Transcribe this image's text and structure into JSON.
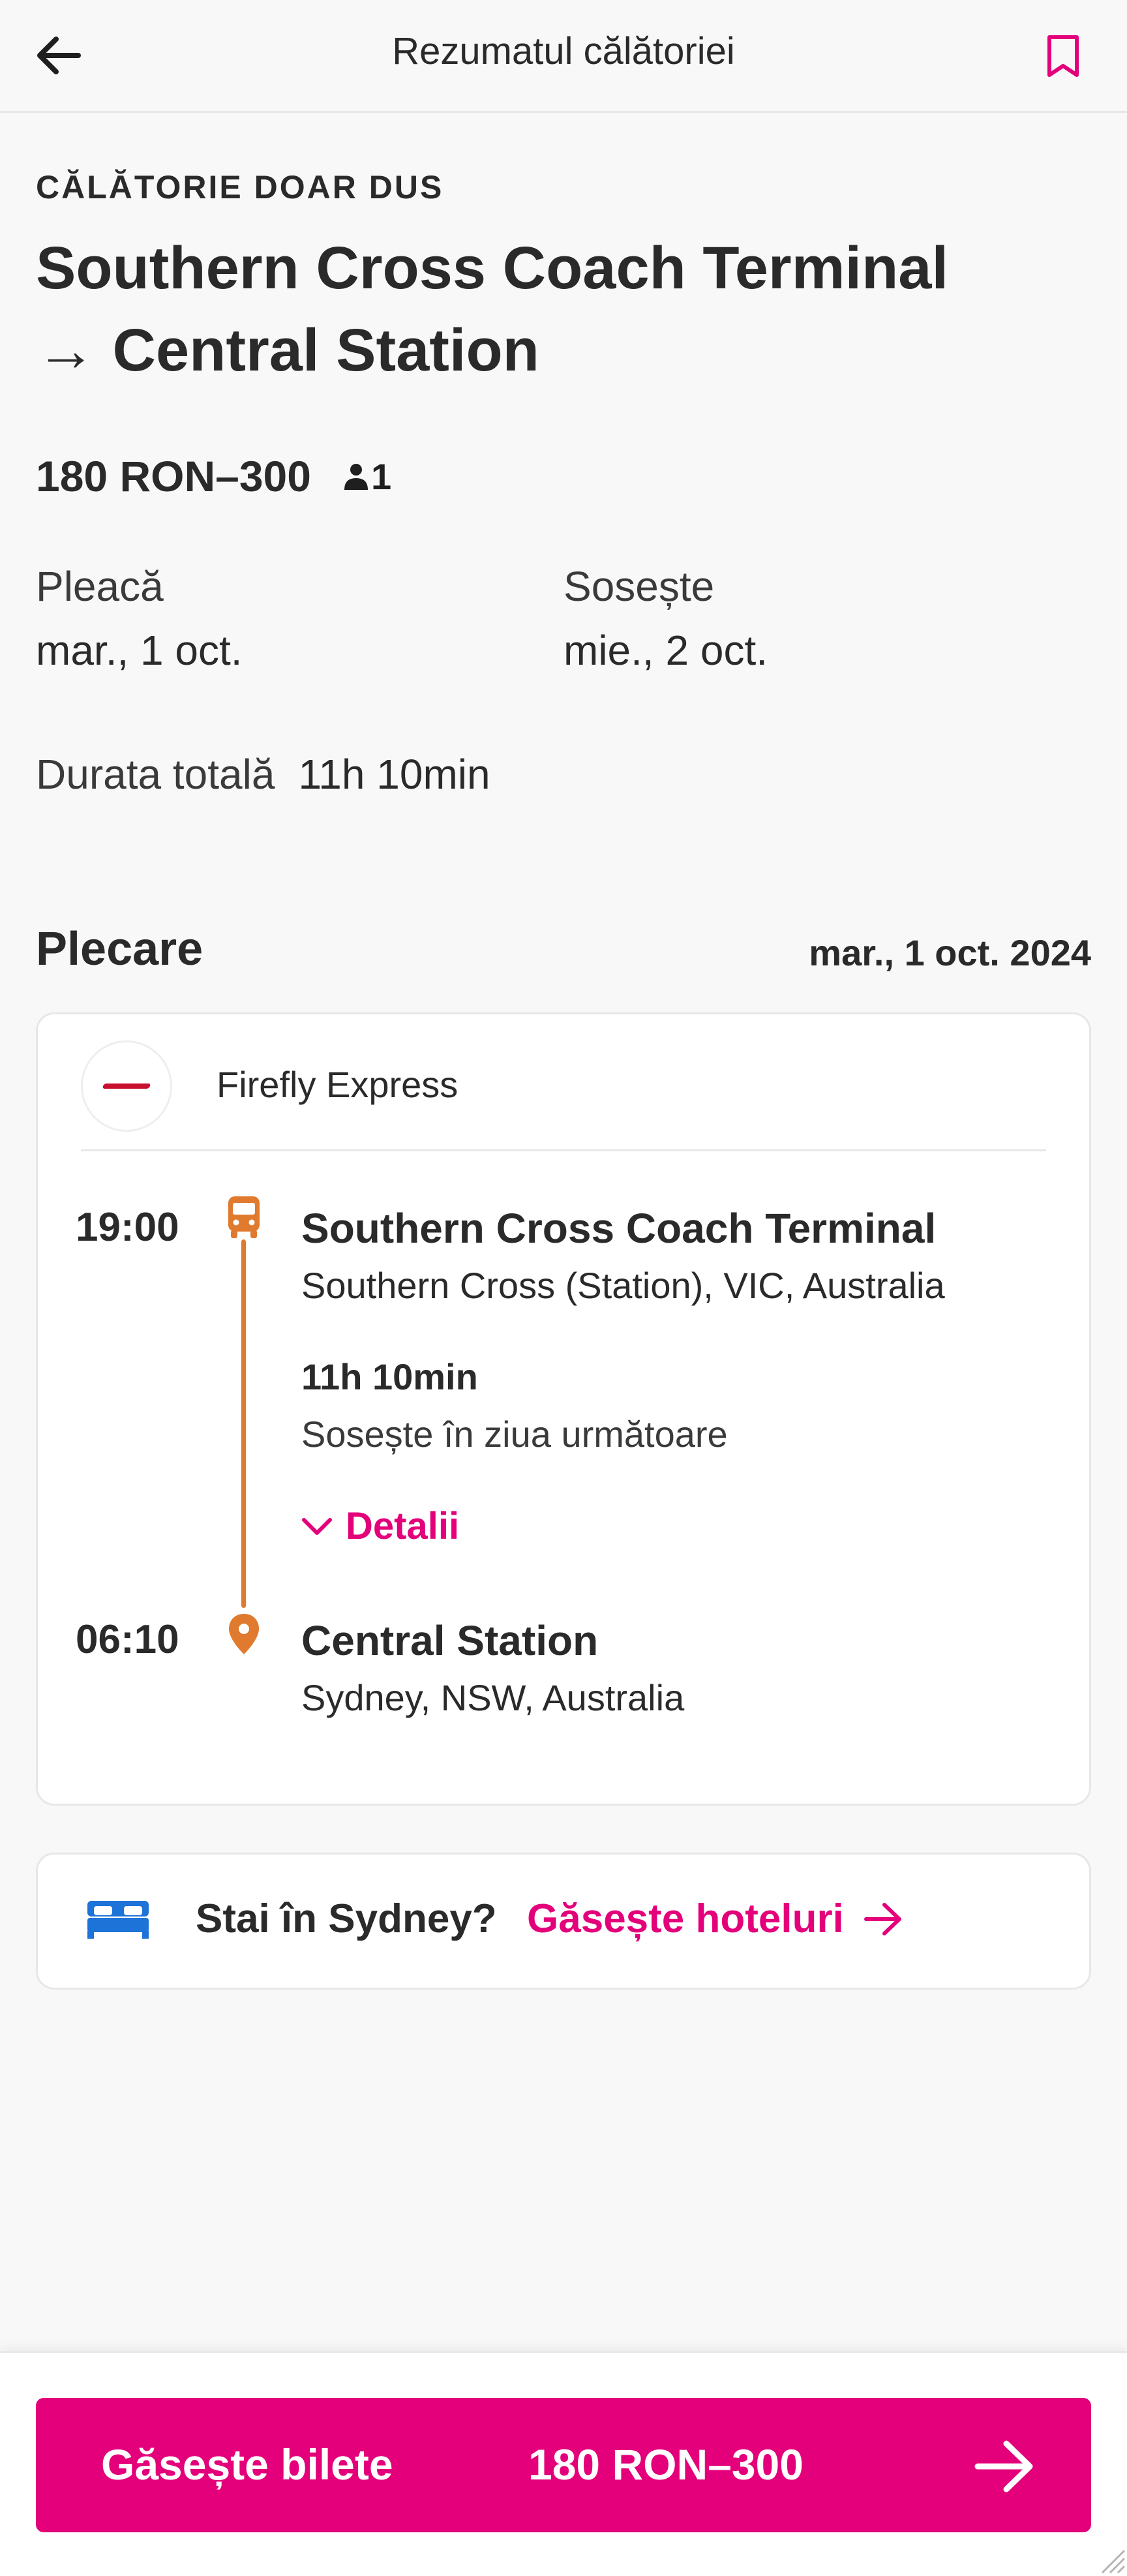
{
  "header": {
    "title": "Rezumatul călătoriei",
    "back_icon": "back-arrow-icon",
    "bookmark_icon": "bookmark-icon"
  },
  "summary": {
    "trip_type": "CĂLĂTORIE DOAR DUS",
    "route_line1": "Southern Cross Coach Terminal",
    "route_line2": "→ Central Station",
    "price": "180 RON–300",
    "passengers": "1",
    "depart_label": "Pleacă",
    "depart_date": "mar., 1 oct.",
    "arrive_label": "Sosește",
    "arrive_date": "mie., 2 oct.",
    "duration_label": "Durata totală",
    "duration_value": "11h 10min"
  },
  "departure_section": {
    "title": "Plecare",
    "date": "mar., 1 oct. 2024"
  },
  "segment": {
    "operator": "Firefly Express",
    "from": {
      "time": "19:00",
      "name": "Southern Cross Coach Terminal",
      "subtitle": "Southern Cross (Station), VIC, Australia"
    },
    "duration": "11h 10min",
    "duration_note": "Sosește în ziua următoare",
    "details_label": "Detalii",
    "to": {
      "time": "06:10",
      "name": "Central Station",
      "subtitle": "Sydney, NSW, Australia"
    }
  },
  "hotel_promo": {
    "question": "Stai în Sydney?",
    "link_label": "Găsește hoteluri"
  },
  "cta": {
    "label": "Găsește bilete",
    "price": "180 RON–300"
  },
  "colors": {
    "accent": "#e3007a",
    "timeline": "#e07a2e",
    "bed_icon": "#1e73d8",
    "operator_brand": "#c8102e"
  }
}
